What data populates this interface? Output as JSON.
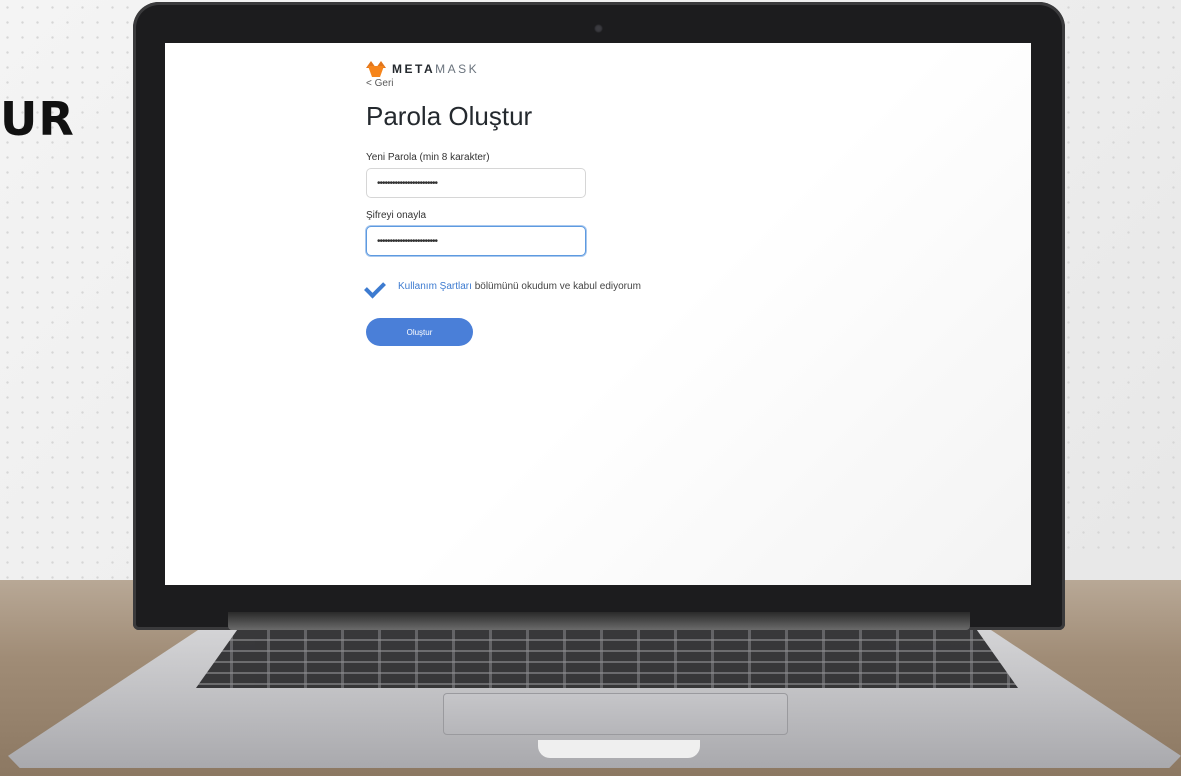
{
  "background": {
    "headline": "UR"
  },
  "metamask": {
    "brand_bold": "META",
    "brand_light": "MASK",
    "back_label": "< Geri",
    "page_title": "Parola Oluştur",
    "new_password": {
      "label": "Yeni Parola (min 8 karakter)",
      "value": "••••••••••••••••••••••••"
    },
    "confirm_password": {
      "label": "Şifreyi onayla",
      "value": "••••••••••••••••••••••••"
    },
    "terms": {
      "checked": true,
      "link_text": "Kullanım Şartları",
      "rest_text": " bölümünü okudum ve kabul ediyorum"
    },
    "submit_label": "Oluştur"
  },
  "colors": {
    "accent": "#4a7fd8",
    "fox": "#f6851b"
  }
}
